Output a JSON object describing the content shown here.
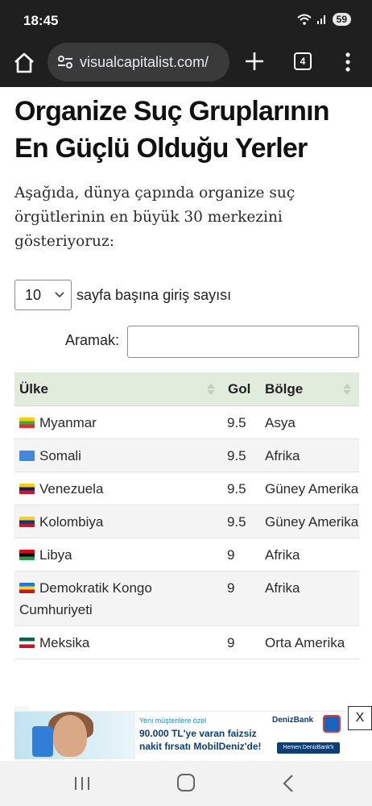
{
  "status": {
    "time": "18:45",
    "battery": "59"
  },
  "browser": {
    "url": "visualcapitalist.com/",
    "tab_count": "4"
  },
  "page": {
    "title": "Organize Suç Gruplarının En Güçlü Olduğu Yerler",
    "intro": "Aşağıda, dünya çapında organize suç örgütlerinin en büyük 30 merkezini gösteriyoruz:"
  },
  "table_controls": {
    "entries_value": "10",
    "entries_label": "sayfa başına giriş sayısı",
    "search_label": "Aramak:",
    "search_value": ""
  },
  "table": {
    "headers": {
      "country": "Ülke",
      "score": "Gol",
      "region": "Bölge"
    },
    "rows": [
      {
        "country": "Myanmar",
        "score": "9.5",
        "region": "Asya",
        "flag": [
          "#fecb00",
          "#34b233",
          "#ea2839"
        ]
      },
      {
        "country": "Somali",
        "score": "9.5",
        "region": "Afrika",
        "flag": [
          "#4189dd",
          "#4189dd",
          "#4189dd"
        ]
      },
      {
        "country": "Venezuela",
        "score": "9.5",
        "region": "Güney Amerika",
        "flag": [
          "#ffcc00",
          "#00247d",
          "#cf142b"
        ]
      },
      {
        "country": "Kolombiya",
        "score": "9.5",
        "region": "Güney Amerika",
        "flag": [
          "#fcd116",
          "#003893",
          "#ce1126"
        ]
      },
      {
        "country": "Libya",
        "score": "9",
        "region": "Afrika",
        "flag": [
          "#e70013",
          "#000000",
          "#239e46"
        ]
      },
      {
        "country": "Demokratik Kongo Cumhuriyeti",
        "score": "9",
        "region": "Afrika",
        "flag": [
          "#007fff",
          "#f7d618",
          "#ce1021"
        ]
      },
      {
        "country": "Meksika",
        "score": "9",
        "region": "Orta Amerika",
        "flag": [
          "#006847",
          "#ffffff",
          "#ce1126"
        ]
      }
    ]
  },
  "ad": {
    "small_text": "Yeni müşterilere özel",
    "line1": "90.000 TL'ye varan faizsiz",
    "line2": "nakit fırsatı MobilDeniz'de!",
    "bank": "DenizBank",
    "cta": "Hemen DenizBank'lı Olun",
    "close_label": "X"
  }
}
